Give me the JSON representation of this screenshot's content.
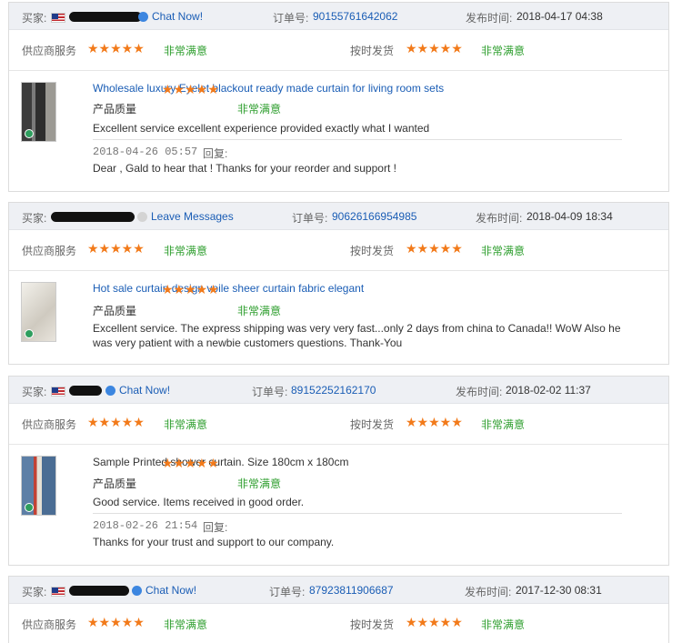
{
  "labels": {
    "buyer": "买家:",
    "order_no": "订单号:",
    "published": "发布时间:",
    "supplier_service": "供应商服务",
    "on_time_delivery": "按时发货",
    "product_quality": "产品质量",
    "very_satisfied": "非常满意",
    "reply": "回复:",
    "stars": "★★★★★"
  },
  "reviews": [
    {
      "contact": "Chat Now!",
      "order_no": "90155761642062",
      "published": "2018-04-17 04:38",
      "product": "Wholesale luxury Eyelet blackout ready made curtain for living room sets",
      "comment": "Excellent service excellent experience provided exactly what I wanted",
      "reply_time": "2018-04-26 05:57",
      "reply_text": "Dear , Gald to hear that ! Thanks for your reorder and support !"
    },
    {
      "contact": "Leave Messages",
      "order_no": "90626166954985",
      "published": "2018-04-09 18:34",
      "product": "Hot sale curtain design voile sheer curtain fabric elegant",
      "comment": "Excellent service. The express shipping was very very fast...only 2 days from china to Canada!! WoW Also he was very patient with a newbie customers questions. Thank-You"
    },
    {
      "contact": "Chat Now!",
      "order_no": "89152252162170",
      "published": "2018-02-02 11:37",
      "product": "Sample Printed shower curtain. Size 180cm x 180cm",
      "comment": "Good service. Items received in good order.",
      "reply_time": "2018-02-26 21:54",
      "reply_text": "Thanks for your trust and support to our company."
    },
    {
      "contact": "Chat Now!",
      "order_no": "87923811906687",
      "published": "2017-12-30 08:31"
    }
  ]
}
